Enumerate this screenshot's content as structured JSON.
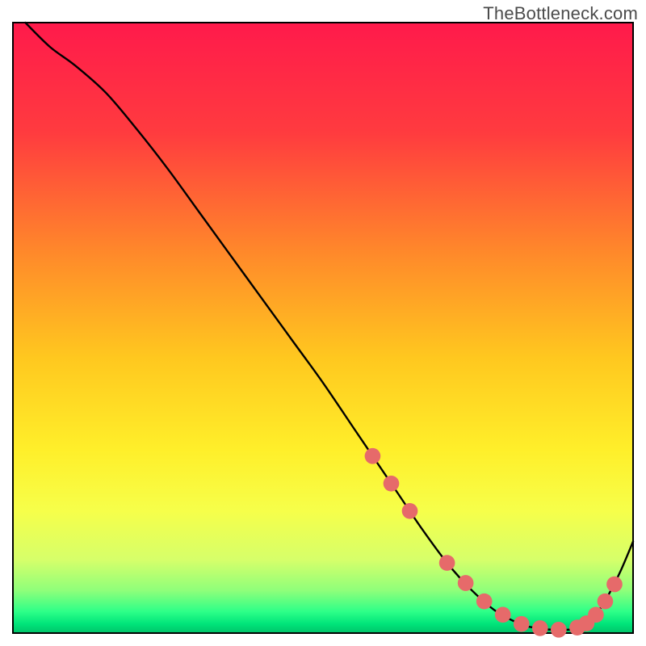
{
  "watermark": "TheBottleneck.com",
  "chart_data": {
    "type": "line",
    "title": "",
    "xlabel": "",
    "ylabel": "",
    "xlim": [
      0,
      100
    ],
    "ylim": [
      0,
      100
    ],
    "gradient_stops": [
      {
        "offset": 0.0,
        "color": "#ff1a4b"
      },
      {
        "offset": 0.18,
        "color": "#ff3b3f"
      },
      {
        "offset": 0.38,
        "color": "#ff8a2a"
      },
      {
        "offset": 0.55,
        "color": "#ffc81f"
      },
      {
        "offset": 0.7,
        "color": "#ffef2a"
      },
      {
        "offset": 0.8,
        "color": "#f6ff4a"
      },
      {
        "offset": 0.88,
        "color": "#d6ff6a"
      },
      {
        "offset": 0.93,
        "color": "#8fff7a"
      },
      {
        "offset": 0.965,
        "color": "#2dff88"
      },
      {
        "offset": 0.985,
        "color": "#00e47a"
      },
      {
        "offset": 1.0,
        "color": "#00c46a"
      }
    ],
    "series": [
      {
        "name": "curve",
        "x": [
          2,
          6,
          10,
          15,
          20,
          25,
          30,
          35,
          40,
          45,
          50,
          55,
          58,
          62,
          66,
          70,
          74,
          78,
          82,
          84,
          86,
          88,
          90,
          92,
          94,
          96,
          98,
          100
        ],
        "y": [
          100,
          96,
          93,
          88.5,
          82.5,
          76,
          69,
          62,
          55,
          48,
          41,
          33.5,
          29,
          23,
          17,
          11.5,
          7,
          3.5,
          1.4,
          0.9,
          0.6,
          0.55,
          0.6,
          1.2,
          3.0,
          6.2,
          10.2,
          15.0
        ]
      }
    ],
    "markers": {
      "name": "dots",
      "color": "#e66a6a",
      "radius_pct": 1.3,
      "points": [
        {
          "x": 58,
          "y": 29
        },
        {
          "x": 61,
          "y": 24.5
        },
        {
          "x": 64,
          "y": 20
        },
        {
          "x": 70,
          "y": 11.5
        },
        {
          "x": 73,
          "y": 8.2
        },
        {
          "x": 76,
          "y": 5.2
        },
        {
          "x": 79,
          "y": 3.0
        },
        {
          "x": 82,
          "y": 1.5
        },
        {
          "x": 85,
          "y": 0.8
        },
        {
          "x": 88,
          "y": 0.55
        },
        {
          "x": 91,
          "y": 0.9
        },
        {
          "x": 92.5,
          "y": 1.6
        },
        {
          "x": 94,
          "y": 3.0
        },
        {
          "x": 95.5,
          "y": 5.2
        },
        {
          "x": 97,
          "y": 8.0
        }
      ]
    },
    "plot_area_inset_pct": {
      "left": 2.0,
      "right": 2.0,
      "top": 3.5,
      "bottom": 2.0
    }
  }
}
